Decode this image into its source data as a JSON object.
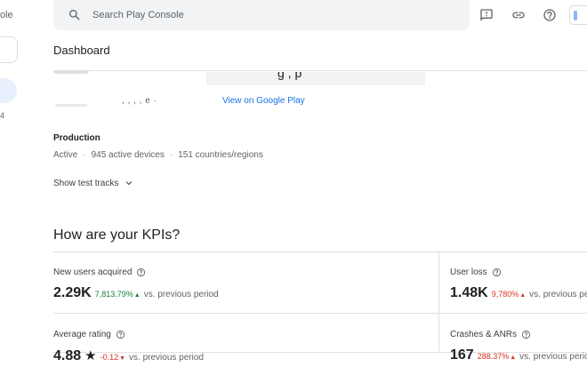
{
  "sidebar": {
    "partial_title": "ole",
    "partial_number": "4"
  },
  "search": {
    "placeholder": "Search Play Console"
  },
  "header": {
    "page_title": "Dashboard"
  },
  "app": {
    "name_fragment": "g , p",
    "meta_fragment": ", ,  ,  ,  e ·",
    "view_link": "View on Google Play"
  },
  "production": {
    "title": "Production",
    "status": "Active",
    "devices": "945 active devices",
    "countries": "151 countries/regions",
    "show_test_tracks": "Show test tracks"
  },
  "kpis": {
    "title": "How are your KPIs?",
    "items": [
      {
        "label": "New users acquired",
        "value": "2.29K",
        "delta": "7,813.79%",
        "trend": "up",
        "trend_color": "#188038",
        "vs": "vs. previous period"
      },
      {
        "label": "User loss",
        "value": "1.48K",
        "delta": "9,780%",
        "trend": "up",
        "trend_color": "#d93025",
        "vs": "vs. previous period"
      },
      {
        "label": "Average rating",
        "value": "4.88",
        "delta": "-0.12",
        "trend": "down",
        "trend_color": "#d93025",
        "vs": "vs. previous period"
      },
      {
        "label": "Crashes & ANRs",
        "value": "167",
        "delta": "288.37%",
        "trend": "up",
        "trend_color": "#d93025",
        "vs": "vs. previous period"
      }
    ]
  },
  "icons": {
    "search": "search-icon",
    "feedback": "feedback-icon",
    "link": "link-icon",
    "help": "help-icon",
    "chevron": "chevron-down-icon",
    "info": "help-outline-icon",
    "star": "star-icon"
  }
}
